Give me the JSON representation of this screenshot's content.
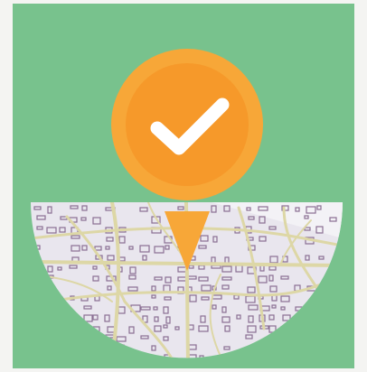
{
  "colors": {
    "background": "#78c28d",
    "pin_outer": "#f7a738",
    "pin_inner": "#f6992a",
    "check": "#ffffff",
    "map_base": "#e9e6ee",
    "map_road": "#ddd7a6",
    "map_building": "#8a6f93"
  },
  "icons": {
    "pin": "location-pin-icon",
    "check": "checkmark-icon",
    "map": "city-map-illustration"
  }
}
